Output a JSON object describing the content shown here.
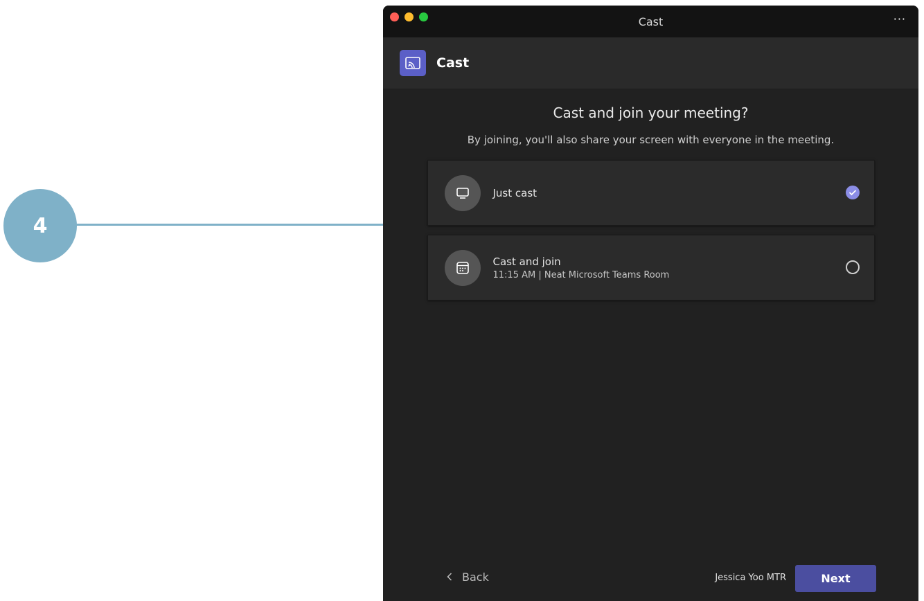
{
  "callout": {
    "number": "4"
  },
  "window": {
    "title": "Cast",
    "more_label": "···"
  },
  "app": {
    "title": "Cast"
  },
  "dialog": {
    "heading": "Cast and join your meeting?",
    "subheading": "By joining, you'll also share your screen with everyone in the meeting."
  },
  "options": [
    {
      "label": "Just cast",
      "icon": "monitor-icon",
      "selected": true
    },
    {
      "label": "Cast and join",
      "detail": "11:15 AM | Neat Microsoft Teams Room",
      "icon": "calendar-icon",
      "selected": false
    }
  ],
  "footer": {
    "back_label": "Back",
    "user_name": "Jessica Yoo MTR",
    "next_label": "Next"
  },
  "colors": {
    "accent": "#5b5fc7",
    "button": "#4b4ea0",
    "callout": "#7fb1c8",
    "radio_checked": "#8b8de6"
  }
}
